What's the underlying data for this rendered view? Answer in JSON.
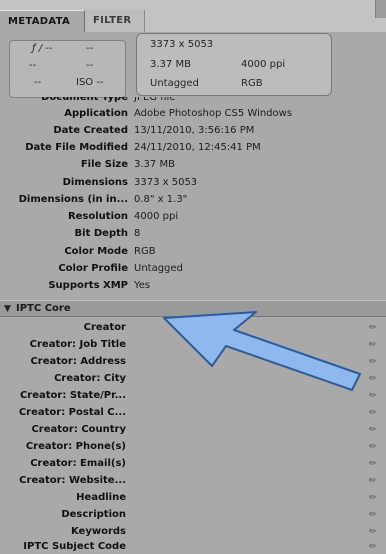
{
  "tabs": [
    {
      "label": "METADATA",
      "active": true
    },
    {
      "label": "FILTER",
      "active": false
    }
  ],
  "quick": {
    "fnumber": "ƒ / --",
    "shutter": "--",
    "exposure_comp": "--",
    "metering": "--",
    "white_balance": "--",
    "iso": "ISO --",
    "dimensions": "3373 x 5053",
    "file_size": "3.37 MB",
    "resolution": "4000 ppi",
    "color_profile": "Untagged",
    "color_mode": "RGB"
  },
  "properties": [
    {
      "label": "Document Type",
      "value": "JPEG file"
    },
    {
      "label": "Application",
      "value": "Adobe Photoshop CS5 Windows"
    },
    {
      "label": "Date Created",
      "value": "13/11/2010, 3:56:16 PM"
    },
    {
      "label": "Date File Modified",
      "value": "24/11/2010, 12:45:41 PM"
    },
    {
      "label": "File Size",
      "value": "3.37 MB"
    },
    {
      "label": "Dimensions",
      "value": "3373 x 5053"
    },
    {
      "label": "Dimensions (in in...",
      "value": "0.8\" x 1.3\""
    },
    {
      "label": "Resolution",
      "value": "4000 ppi"
    },
    {
      "label": "Bit Depth",
      "value": "8"
    },
    {
      "label": "Color Mode",
      "value": "RGB"
    },
    {
      "label": "Color Profile",
      "value": "Untagged"
    },
    {
      "label": "Supports XMP",
      "value": "Yes"
    }
  ],
  "iptc": {
    "title": "IPTC Core",
    "fields": [
      "Creator",
      "Creator: Job Title",
      "Creator: Address",
      "Creator: City",
      "Creator: State/Pr...",
      "Creator: Postal C...",
      "Creator: Country",
      "Creator: Phone(s)",
      "Creator: Email(s)",
      "Creator: Website...",
      "Headline",
      "Description",
      "Keywords",
      "IPTC Subject Code"
    ]
  },
  "icons": {
    "edit": "pencil-icon",
    "disclosure": "triangle-down-icon"
  },
  "colors": {
    "panel": "#a9a9a9",
    "arrow": "#8fb8ee"
  }
}
